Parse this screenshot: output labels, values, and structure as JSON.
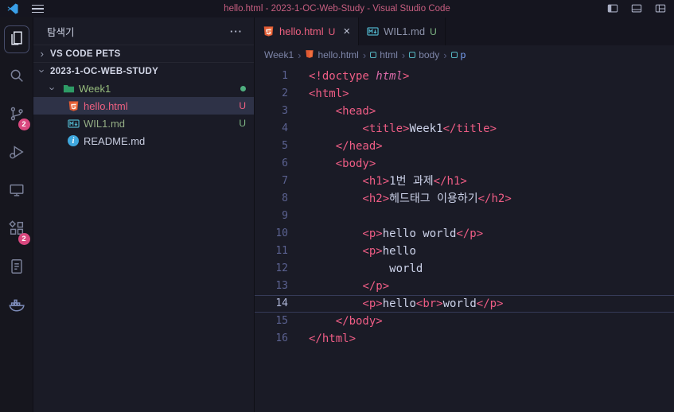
{
  "colors": {
    "accent_pink": "#ef5d85",
    "badge_pink": "#d9477e",
    "untracked_green": "#7fb685",
    "folder_green": "#2e9b66",
    "breadcrumb_current_blue": "#7aa2f7"
  },
  "title_bar": {
    "title": "hello.html - 2023-1-OC-Web-Study - Visual Studio Code"
  },
  "activity_bar": {
    "items": [
      {
        "id": "explorer",
        "active": true
      },
      {
        "id": "search"
      },
      {
        "id": "source-control",
        "badge": "2"
      },
      {
        "id": "run-and-debug"
      },
      {
        "id": "remote-explorer"
      },
      {
        "id": "extensions",
        "badge": "2"
      },
      {
        "id": "notes"
      },
      {
        "id": "docker"
      }
    ]
  },
  "sidebar": {
    "title": "탐색기",
    "more_actions": "···",
    "sections": [
      {
        "label": "VS CODE PETS",
        "expanded": false
      },
      {
        "label": "2023-1-OC-WEB-STUDY",
        "expanded": true
      }
    ],
    "tree": [
      {
        "label": "Week1",
        "type": "folder",
        "expanded": true,
        "has_changes_dot": true
      },
      {
        "label": "hello.html",
        "type": "html",
        "git_status": "U",
        "selected": true
      },
      {
        "label": "WIL1.md",
        "type": "markdown",
        "git_status": "U"
      },
      {
        "label": "README.md",
        "type": "readme",
        "git_status": ""
      }
    ]
  },
  "editor": {
    "tabs": [
      {
        "label": "hello.html",
        "git_status": "U",
        "close": "×",
        "active": true
      },
      {
        "label": "WIL1.md",
        "git_status": "U",
        "active": false
      }
    ],
    "breadcrumbs": [
      {
        "label": "Week1"
      },
      {
        "label": "hello.html",
        "icon": "html-file"
      },
      {
        "label": "html",
        "icon": "symbol"
      },
      {
        "label": "body",
        "icon": "symbol"
      },
      {
        "label": "p",
        "icon": "symbol",
        "current": true
      }
    ],
    "active_line": 14,
    "lines": [
      {
        "n": 1,
        "tokens": [
          {
            "t": "<!doctype ",
            "c": "tag"
          },
          {
            "t": "html",
            "c": "attr"
          },
          {
            "t": ">",
            "c": "tag"
          }
        ]
      },
      {
        "n": 2,
        "tokens": [
          {
            "t": "<html>",
            "c": "tag"
          }
        ]
      },
      {
        "n": 3,
        "tokens": [
          {
            "t": "    ",
            "c": "plain"
          },
          {
            "t": "<head>",
            "c": "tag"
          }
        ]
      },
      {
        "n": 4,
        "tokens": [
          {
            "t": "        ",
            "c": "plain"
          },
          {
            "t": "<title>",
            "c": "tag"
          },
          {
            "t": "Week1",
            "c": "plain"
          },
          {
            "t": "</title>",
            "c": "tag"
          }
        ]
      },
      {
        "n": 5,
        "tokens": [
          {
            "t": "    ",
            "c": "plain"
          },
          {
            "t": "</head>",
            "c": "tag"
          }
        ]
      },
      {
        "n": 6,
        "tokens": [
          {
            "t": "    ",
            "c": "plain"
          },
          {
            "t": "<body>",
            "c": "tag"
          }
        ]
      },
      {
        "n": 7,
        "tokens": [
          {
            "t": "        ",
            "c": "plain"
          },
          {
            "t": "<h1>",
            "c": "tag"
          },
          {
            "t": "1번 과제",
            "c": "plain"
          },
          {
            "t": "</h1>",
            "c": "tag"
          }
        ]
      },
      {
        "n": 8,
        "tokens": [
          {
            "t": "        ",
            "c": "plain"
          },
          {
            "t": "<h2>",
            "c": "tag"
          },
          {
            "t": "헤드태그 이용하기",
            "c": "plain"
          },
          {
            "t": "</h2>",
            "c": "tag"
          }
        ]
      },
      {
        "n": 9,
        "tokens": []
      },
      {
        "n": 10,
        "tokens": [
          {
            "t": "        ",
            "c": "plain"
          },
          {
            "t": "<p>",
            "c": "tag"
          },
          {
            "t": "hello world",
            "c": "plain"
          },
          {
            "t": "</p>",
            "c": "tag"
          }
        ]
      },
      {
        "n": 11,
        "tokens": [
          {
            "t": "        ",
            "c": "plain"
          },
          {
            "t": "<p>",
            "c": "tag"
          },
          {
            "t": "hello",
            "c": "plain"
          }
        ]
      },
      {
        "n": 12,
        "tokens": [
          {
            "t": "            ",
            "c": "plain"
          },
          {
            "t": "world",
            "c": "plain"
          }
        ]
      },
      {
        "n": 13,
        "tokens": [
          {
            "t": "        ",
            "c": "plain"
          },
          {
            "t": "</p>",
            "c": "tag"
          }
        ]
      },
      {
        "n": 14,
        "tokens": [
          {
            "t": "        ",
            "c": "plain"
          },
          {
            "t": "<p>",
            "c": "tag"
          },
          {
            "t": "hello",
            "c": "plain"
          },
          {
            "t": "<br>",
            "c": "tag"
          },
          {
            "t": "world",
            "c": "plain"
          },
          {
            "t": "</p>",
            "c": "tag"
          }
        ]
      },
      {
        "n": 15,
        "tokens": [
          {
            "t": "    ",
            "c": "plain"
          },
          {
            "t": "</body>",
            "c": "tag"
          }
        ]
      },
      {
        "n": 16,
        "tokens": [
          {
            "t": "</html>",
            "c": "tag"
          }
        ]
      }
    ]
  }
}
